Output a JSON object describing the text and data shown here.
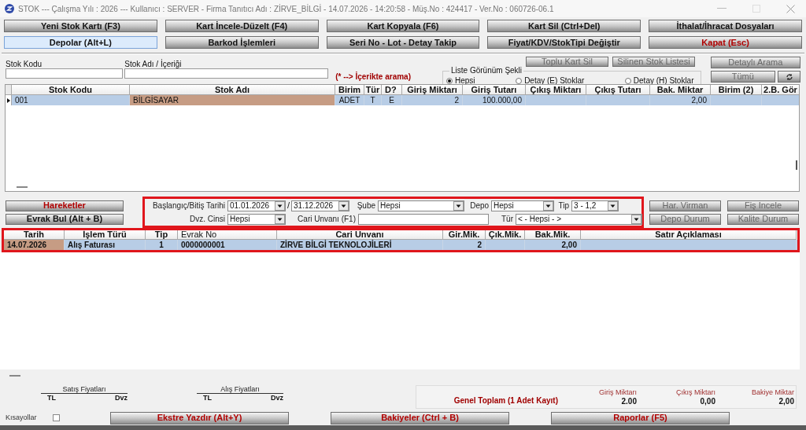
{
  "window": {
    "title": "STOK --- Çalışma Yılı : 2026 --- Kullanıcı : SERVER - Firma Tanıtıcı Adı : ZİRVE_BİLGİ - 14.07.2026 - 14:20:58 - Müş.No : 424417 - Ver.No : 060726-06.1"
  },
  "toolbar": [
    {
      "label": "Yeni Stok Kartı (F3)",
      "kind": "normal",
      "selected": false
    },
    {
      "label": "Kart İncele-Düzelt (F4)",
      "kind": "normal",
      "selected": false
    },
    {
      "label": "Kart Kopyala (F6)",
      "kind": "normal",
      "selected": false
    },
    {
      "label": "Kart Sil (Ctrl+Del)",
      "kind": "normal",
      "selected": false
    },
    {
      "label": "İthalat/İhracat Dosyaları",
      "kind": "normal",
      "selected": false
    },
    {
      "label": "Depolar (Alt+L)",
      "kind": "normal",
      "selected": true
    },
    {
      "label": "Barkod İşlemleri",
      "kind": "normal",
      "selected": false
    },
    {
      "label": "Seri No - Lot - Detay Takip",
      "kind": "normal",
      "selected": false
    },
    {
      "label": "Fiyat/KDV/StokTipi Değiştir",
      "kind": "normal",
      "selected": false
    },
    {
      "label": "Kapat (Esc)",
      "kind": "danger",
      "selected": false
    }
  ],
  "search": {
    "code_label": "Stok Kodu",
    "name_label": "Stok Adı / İçeriği",
    "hint": "(* --> İçerikte arama)"
  },
  "view_mode": {
    "legend": "Liste Görünüm Şekli",
    "options": [
      {
        "label": "Hepsi",
        "selected": true
      },
      {
        "label": "Detay (E) Stoklar",
        "selected": false
      },
      {
        "label": "Detay (H) Stoklar",
        "selected": false
      }
    ]
  },
  "search_buttons": [
    {
      "label": "Toplu Kart Sil",
      "kind": "muted"
    },
    {
      "label": "Silinen Stok Listesi",
      "kind": "muted"
    },
    {
      "label": "Detaylı Arama",
      "kind": "muted"
    },
    {
      "label": "Tümü",
      "kind": "muted"
    }
  ],
  "stock_table": {
    "columns": [
      "Stok Kodu",
      "Stok Adı",
      "Birim",
      "Tür",
      "D?",
      "Giriş Miktarı",
      "Giriş Tutarı",
      "Çıkış Miktarı",
      "Çıkış Tutarı",
      "Bak. Miktar",
      "Birim (2)",
      "2.B. Gör"
    ],
    "rows": [
      {
        "selected": true,
        "cells": [
          "001",
          {
            "text": "BİLGİSAYAR",
            "focused": true
          },
          "ADET",
          "T",
          "E",
          "2",
          "100.000,00",
          null,
          null,
          "2,00",
          null,
          null
        ]
      }
    ]
  },
  "movement_buttons": [
    {
      "label": "Hareketler",
      "kind": "danger"
    },
    {
      "label": "Evrak Bul (Alt + B)",
      "kind": "normal"
    }
  ],
  "filters": [
    {
      "kind": "date_range",
      "label": "Başlangıç/Bitiş Tarihi",
      "from": "01.01.2026",
      "separator": "/",
      "to": "31.12.2026"
    },
    {
      "kind": "combo",
      "label": "Şube",
      "value": "Hepsi"
    },
    {
      "kind": "combo",
      "label": "Depo",
      "value": "Hepsi"
    },
    {
      "kind": "combo",
      "label": "Tip",
      "value": "3 - 1,2"
    },
    {
      "kind": "combo",
      "label": "Dvz. Cinsi",
      "value": "Hepsi"
    },
    {
      "kind": "text",
      "label": "Cari Unvanı (F1)"
    },
    {
      "kind": "combo",
      "label": "Tür",
      "value": "< - Hepsi - >"
    }
  ],
  "side_buttons": [
    {
      "label": "Har. Virman",
      "kind": "muted"
    },
    {
      "label": "Fiş İncele",
      "kind": "muted"
    },
    {
      "label": "Depo Durum",
      "kind": "muted"
    },
    {
      "label": "Kalite Durum",
      "kind": "muted"
    }
  ],
  "movement_table": {
    "columns": [
      "Tarih",
      "İşlem Türü",
      "Tip",
      "Evrak No",
      "Cari Unvanı",
      "Gir.Mik.",
      "Çık.Mik.",
      "Bak.Mik.",
      "Satır Açıklaması"
    ],
    "rows": [
      {
        "selected": true,
        "cells": [
          {
            "text": "14.07.2026",
            "focused": true
          },
          "Alış Faturası",
          "1",
          "0000000001",
          "ZİRVE BİLGİ TEKNOLOJİLERİ",
          "2",
          null,
          "2,00",
          null
        ]
      }
    ]
  },
  "prices": [
    {
      "title": "Satış Fiyatları",
      "columns": [
        "TL",
        "Dvz"
      ]
    },
    {
      "title": "Alış Fiyatları",
      "columns": [
        "TL",
        "Dvz"
      ]
    }
  ],
  "totals": {
    "label": "Genel Toplam (1 Adet Kayıt)",
    "columns": [
      {
        "label": "Giriş Miktarı",
        "value": "2.00"
      },
      {
        "label": "Çıkış Miktarı",
        "value": "0,00"
      },
      {
        "label": "Bakiye Miktar",
        "value": "2,00"
      }
    ]
  },
  "footer": {
    "shortcuts": {
      "label": "Kısayollar",
      "checked": false
    },
    "buttons": [
      {
        "label": "Ekstre Yazdır (Alt+Y)",
        "kind": "danger"
      },
      {
        "label": "Bakiyeler (Ctrl + B)",
        "kind": "danger"
      },
      {
        "label": "Raporlar (F5)",
        "kind": "danger"
      }
    ]
  }
}
